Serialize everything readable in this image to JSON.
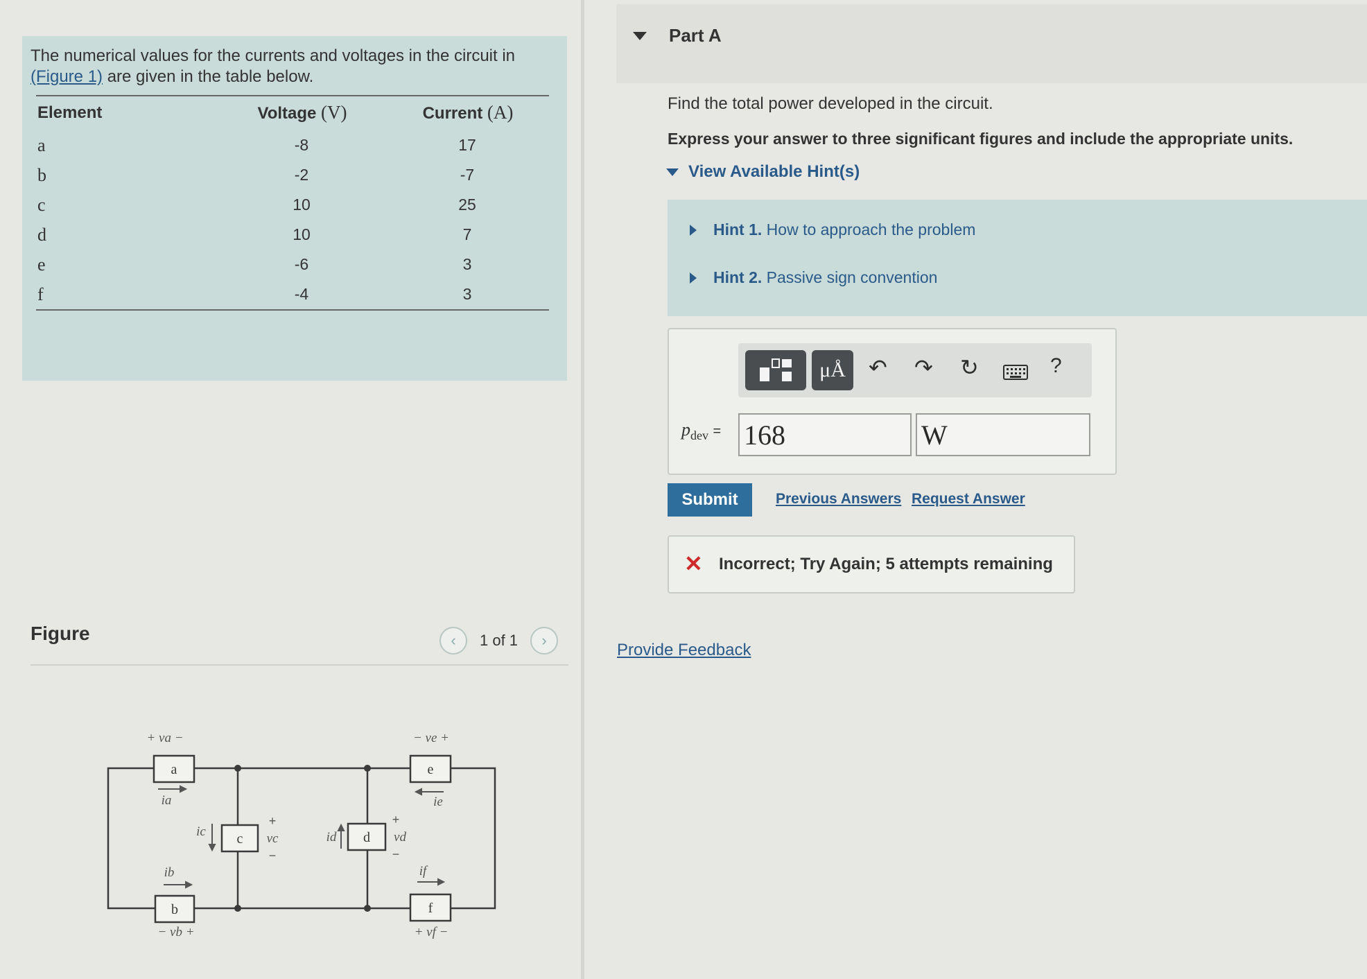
{
  "problem": {
    "intro_before_link": "The numerical values for the currents and voltages in the circuit in",
    "figure_link": "(Figure 1)",
    "intro_after_link": "are given in the table below.",
    "table": {
      "headers": {
        "element": "Element",
        "voltage": "Voltage",
        "voltage_unit": "(V)",
        "current": "Current",
        "current_unit": "(A)"
      },
      "rows": [
        {
          "element": "a",
          "voltage": "-8",
          "current": "17"
        },
        {
          "element": "b",
          "voltage": "-2",
          "current": "-7"
        },
        {
          "element": "c",
          "voltage": "10",
          "current": "25"
        },
        {
          "element": "d",
          "voltage": "10",
          "current": "7"
        },
        {
          "element": "e",
          "voltage": "-6",
          "current": "3"
        },
        {
          "element": "f",
          "voltage": "-4",
          "current": "3"
        }
      ]
    }
  },
  "figure": {
    "title": "Figure",
    "pager": "1 of 1",
    "prev_icon": "chevron-left-icon",
    "next_icon": "chevron-right-icon",
    "circuit_labels": {
      "elements": [
        "a",
        "b",
        "c",
        "d",
        "e",
        "f"
      ],
      "va": "+ va −",
      "vb": "− vb +",
      "ve": "− ve +",
      "vf": "+ vf −",
      "vc": "vc",
      "vd": "vd",
      "ia": "ia",
      "ib": "ib",
      "ic": "ic",
      "id": "id",
      "ie": "ie",
      "if": "if"
    }
  },
  "part": {
    "title": "Part A",
    "question": "Find the total power developed in the circuit.",
    "instruction": "Express your answer to three significant figures and include the appropriate units.",
    "hints_toggle": "View Available Hint(s)",
    "hints": [
      {
        "number": "Hint 1.",
        "text": "How to approach the problem"
      },
      {
        "number": "Hint 2.",
        "text": "Passive sign convention"
      }
    ],
    "toolbar": {
      "templates_icon": "templates-icon",
      "units_label": "μÅ",
      "undo_icon": "undo-icon",
      "redo_icon": "redo-icon",
      "reset_icon": "reset-icon",
      "keyboard_icon": "keyboard-icon",
      "help_label": "?"
    },
    "answer": {
      "label_var": "p",
      "label_sub": "dev",
      "label_eq": "=",
      "value": "168",
      "unit": "W"
    },
    "submit_label": "Submit",
    "previous_answers": "Previous Answers",
    "request_answer": "Request Answer",
    "feedback_icon": "x-icon",
    "feedback_mark": "✕",
    "feedback_text": "Incorrect; Try Again; 5 attempts remaining",
    "provide_feedback": "Provide Feedback"
  },
  "colors": {
    "panel_teal": "#c9dcd9",
    "link_blue": "#2a5a8a",
    "submit_blue": "#2d6e9d",
    "error_red": "#cf2a2a"
  }
}
